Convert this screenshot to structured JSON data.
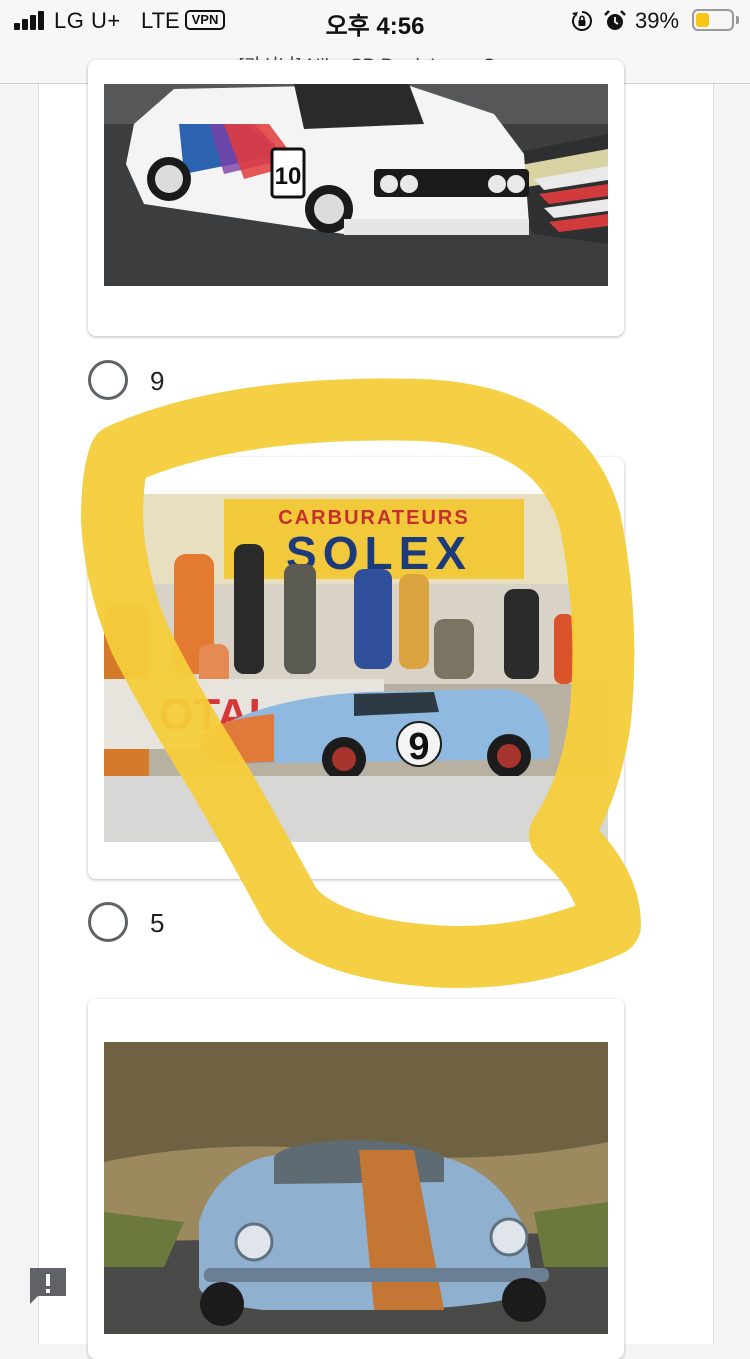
{
  "status_bar": {
    "carrier": "LG U+",
    "network": "LTE",
    "vpn": "VPN",
    "time": "오후 4:56",
    "battery_percent": "39%",
    "battery_level": 0.39,
    "battery_color": "#f5c518"
  },
  "browser": {
    "page_title": "[카시나] Nike SB Dunk Low - C..."
  },
  "form": {
    "options": [
      {
        "label": "9",
        "image_text": {
          "number": "10"
        }
      },
      {
        "label": "5",
        "image_text": {
          "banner_top": "CARBURATEURS",
          "banner_main": "SOLEX",
          "number": "9"
        }
      }
    ]
  },
  "icons": {
    "signal": "signal-bars-icon",
    "rotation_lock": "rotation-lock-icon",
    "alarm": "alarm-icon",
    "battery": "battery-icon",
    "feedback": "report-feedback-icon"
  },
  "colors": {
    "highlighter": "#f6cd3a",
    "radio_border": "#5f6368",
    "card_background": "#ffffff",
    "page_background": "#f4f4f4"
  }
}
